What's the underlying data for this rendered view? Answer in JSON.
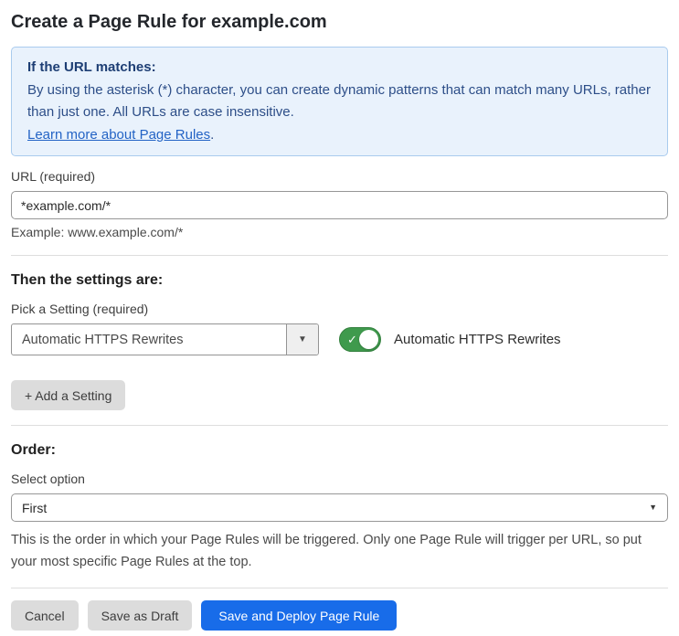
{
  "page": {
    "title": "Create a Page Rule for example.com"
  },
  "info_box": {
    "heading": "If the URL matches:",
    "body": "By using the asterisk (*) character, you can create dynamic patterns that can match many URLs, rather than just one. All URLs are case insensitive.",
    "link_label": "Learn more about Page Rules",
    "link_suffix": "."
  },
  "url_field": {
    "label": "URL (required)",
    "value": "*example.com/*",
    "helper": "Example: www.example.com/*"
  },
  "settings_section": {
    "heading": "Then the settings are:",
    "picker_label": "Pick a Setting (required)",
    "picker_value": "Automatic HTTPS Rewrites",
    "caret_icon": "▼",
    "toggle_state": "on",
    "toggle_check_icon": "✓",
    "toggle_label": "Automatic HTTPS Rewrites",
    "add_setting_button": "+ Add a Setting"
  },
  "order_section": {
    "heading": "Order:",
    "select_label": "Select option",
    "select_value": "First",
    "caret_icon": "▼",
    "helper": "This is the order in which your Page Rules will be triggered. Only one Page Rule will trigger per URL, so put your most specific Page Rules at the top."
  },
  "footer": {
    "cancel_button": "Cancel",
    "save_draft_button": "Save as Draft",
    "save_deploy_button": "Save and Deploy Page Rule"
  },
  "colors": {
    "info_box_bg": "#e9f2fc",
    "info_box_border": "#a9cbee",
    "info_text_blue": "#2d4e88",
    "link_blue": "#2363c5",
    "toggle_green": "#3f9a4d",
    "primary_button_blue": "#186ce9",
    "secondary_button_gray": "#dcdcdc",
    "input_border_gray": "#979797"
  }
}
